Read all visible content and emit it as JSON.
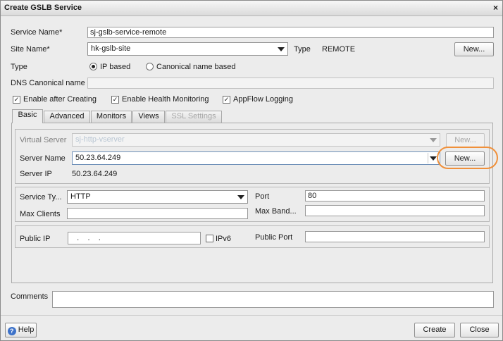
{
  "window": {
    "title": "Create GSLB Service",
    "close_glyph": "×"
  },
  "form": {
    "service_name_label": "Service Name*",
    "service_name_value": "sj-gslb-service-remote",
    "site_name_label": "Site Name*",
    "site_name_value": "hk-gslb-site",
    "type_inline_label": "Type",
    "type_inline_value": "REMOTE",
    "site_new_button": "New...",
    "type_label": "Type",
    "type_options": [
      "IP based",
      "Canonical name based"
    ],
    "type_selected": "IP based",
    "dns_canonical_label": "DNS Canonical name",
    "dns_canonical_value": "",
    "checkboxes": [
      {
        "label": "Enable after Creating",
        "checked": true
      },
      {
        "label": "Enable Health Monitoring",
        "checked": true
      },
      {
        "label": "AppFlow Logging",
        "checked": true
      }
    ]
  },
  "tabs": [
    {
      "label": "Basic",
      "active": true,
      "enabled": true
    },
    {
      "label": "Advanced",
      "active": false,
      "enabled": true
    },
    {
      "label": "Monitors",
      "active": false,
      "enabled": true
    },
    {
      "label": "Views",
      "active": false,
      "enabled": true
    },
    {
      "label": "SSL Settings",
      "active": false,
      "enabled": false
    }
  ],
  "basic": {
    "virtual_server_label": "Virtual Server",
    "virtual_server_value": "sj-http-vserver",
    "virtual_server_new": "New...",
    "server_name_label": "Server Name",
    "server_name_value": "50.23.64.249",
    "server_name_new": "New...",
    "server_ip_label": "Server IP",
    "server_ip_value": "50.23.64.249",
    "service_type_label": "Service Ty...",
    "service_type_value": "HTTP",
    "port_label": "Port",
    "port_value": "80",
    "max_clients_label": "Max Clients",
    "max_clients_value": "",
    "max_band_label": "Max Band...",
    "max_band_value": "",
    "public_ip_label": "Public IP",
    "public_ip_value": "   .    .    .",
    "ipv6_label": "IPv6",
    "ipv6_checked": false,
    "public_port_label": "Public Port",
    "public_port_value": ""
  },
  "comments": {
    "label": "Comments",
    "value": ""
  },
  "footer": {
    "help": "Help",
    "create": "Create",
    "close": "Close"
  },
  "accent_colors": {
    "highlight_ring": "#f0903a",
    "help_icon": "#3d72c9"
  }
}
